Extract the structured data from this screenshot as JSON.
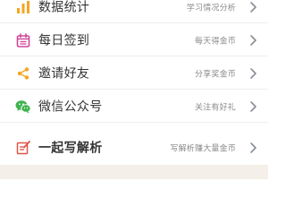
{
  "menu": {
    "items": [
      {
        "label": "数据统计",
        "hint": "学习情况分析",
        "icon": "bar-chart-icon",
        "icon_color": "#f5a623"
      },
      {
        "label": "每日签到",
        "hint": "每天得金币",
        "icon": "calendar-icon",
        "icon_color": "#d0469a"
      },
      {
        "label": "邀请好友",
        "hint": "分享奖金币",
        "icon": "share-icon",
        "icon_color": "#f5a623"
      },
      {
        "label": "微信公众号",
        "hint": "关注有好礼",
        "icon": "wechat-icon",
        "icon_color": "#3fb34f"
      },
      {
        "label": "一起写解析",
        "hint": "写解析赚大量金币",
        "icon": "edit-note-icon",
        "icon_color": "#e05545"
      }
    ]
  },
  "colors": {
    "text": "#333333",
    "hint": "#8a8a8a",
    "chevron": "#8a8f96",
    "divider": "#ededed",
    "footer": "#f4efe8"
  }
}
